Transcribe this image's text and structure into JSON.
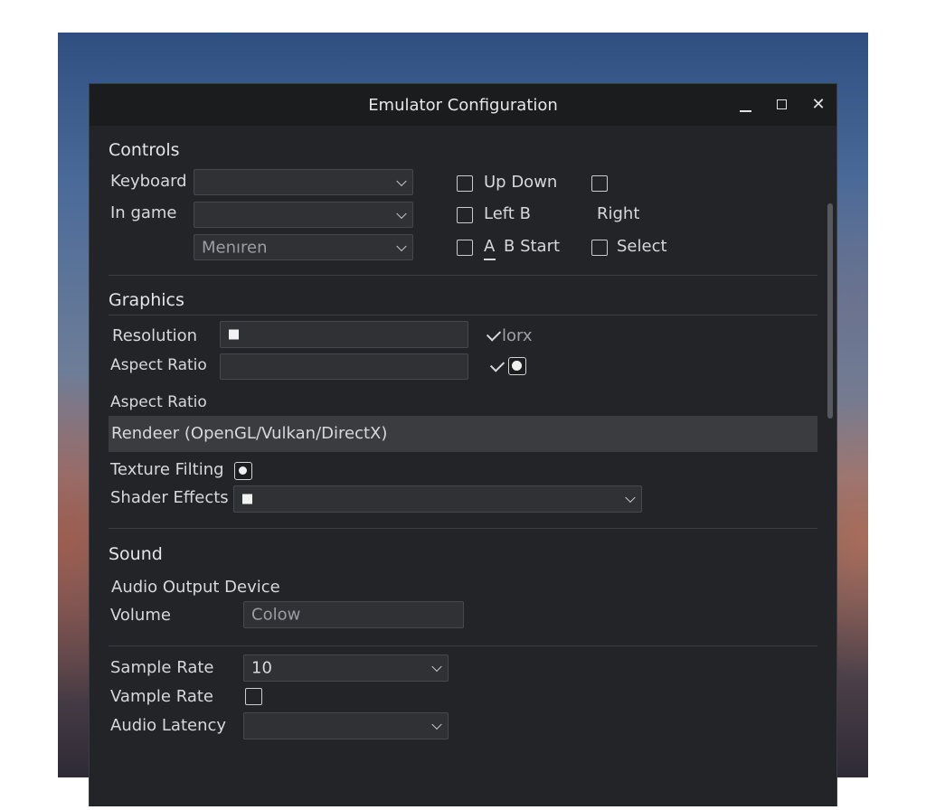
{
  "window": {
    "title": "Emulator Configuration"
  },
  "controls": {
    "section": "Controls",
    "keyboard_label": "Keyboard",
    "ingame_label": "In game",
    "menu_value": "Menıren",
    "buttons": {
      "up_down": "Up  Down",
      "left_b": "Left B",
      "right": "Right",
      "a": "A",
      "b_start": "B  Start",
      "select": "Select"
    }
  },
  "graphics": {
    "section": "Graphics",
    "resolution_label": "Resolution",
    "aspect_ratio_label": "Aspect Ratio",
    "lorx_label": "lorx",
    "aspect_ratio_label_2": "Aspect Ratio",
    "renderer_label": "Rendeer (OpenGL/Vulkan/DirectX)",
    "texture_filtering_label": "Texture Filting",
    "shader_effects_label": "Shader Effects"
  },
  "sound": {
    "section": "Sound",
    "audio_output_label": "Audio Output Device",
    "volume_label": "Volume",
    "volume_value": "Colow",
    "sample_rate_label": "Sample Rate",
    "sample_rate_value": "10",
    "vample_rate_label": "Vample Rate",
    "audio_latency_label": "Audio Latency"
  }
}
